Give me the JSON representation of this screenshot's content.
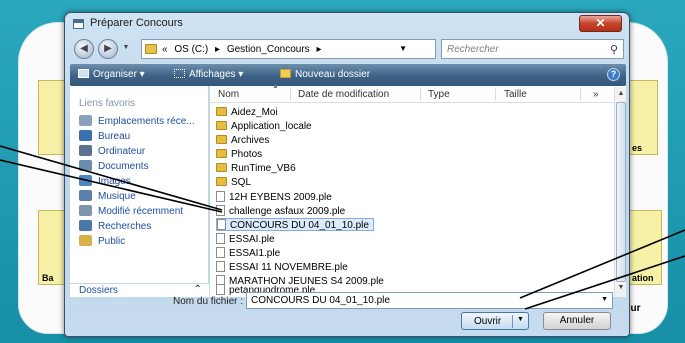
{
  "background": {
    "tile_left_bottom": "Ba",
    "tile_right_top": "es",
    "tile_right_bottom": "ation",
    "bottom_text": "eur"
  },
  "dialog": {
    "title": "Préparer Concours",
    "close_label": "✕"
  },
  "address_bar": {
    "crumbs": [
      "«",
      "OS (C:)",
      "▸",
      "Gestion_Concours",
      "▸"
    ],
    "search_placeholder": "Rechercher"
  },
  "toolbar": {
    "organize": "Organiser ▾",
    "views": "Affichages ▾",
    "new_folder": "Nouveau dossier"
  },
  "nav": {
    "header": "Liens favoris",
    "items": [
      {
        "label": "Emplacements réce...",
        "icon": "recent-places-icon",
        "color": "#8aa1b9"
      },
      {
        "label": "Bureau",
        "icon": "desktop-icon",
        "color": "#3a6fb0"
      },
      {
        "label": "Ordinateur",
        "icon": "computer-icon",
        "color": "#5b7390"
      },
      {
        "label": "Documents",
        "icon": "documents-icon",
        "color": "#6c8db0"
      },
      {
        "label": "Images",
        "icon": "pictures-icon",
        "color": "#4f86c2"
      },
      {
        "label": "Musique",
        "icon": "music-icon",
        "color": "#5a7fa8"
      },
      {
        "label": "Modifié récemment",
        "icon": "recently-changed-icon",
        "color": "#7f95ad"
      },
      {
        "label": "Recherches",
        "icon": "searches-icon",
        "color": "#4b77a8"
      },
      {
        "label": "Public",
        "icon": "public-folder-icon",
        "color": "#d9b14a"
      }
    ],
    "footer": "Dossiers"
  },
  "columns": {
    "name": "Nom",
    "modified": "Date de modification",
    "type": "Type",
    "size": "Taille",
    "more": "»"
  },
  "files": [
    {
      "name": "Aidez_Moi",
      "kind": "folder"
    },
    {
      "name": "Application_locale",
      "kind": "folder"
    },
    {
      "name": "Archives",
      "kind": "folder"
    },
    {
      "name": "Photos",
      "kind": "folder"
    },
    {
      "name": "RunTime_VB6",
      "kind": "folder"
    },
    {
      "name": "SQL",
      "kind": "folder"
    },
    {
      "name": "12H EYBENS 2009.ple",
      "kind": "file"
    },
    {
      "name": "challenge asfaux 2009.ple",
      "kind": "file"
    },
    {
      "name": "CONCOURS DU 04_01_10.ple",
      "kind": "file",
      "selected": true
    },
    {
      "name": "ESSAI.ple",
      "kind": "file"
    },
    {
      "name": "ESSAI1.ple",
      "kind": "file"
    },
    {
      "name": "ESSAI 11 NOVEMBRE.ple",
      "kind": "file"
    },
    {
      "name": "MARATHON JEUNES S4 2009.ple",
      "kind": "file"
    },
    {
      "name": "petanquodrome.ple",
      "kind": "file"
    }
  ],
  "footer": {
    "filename_label": "Nom du fichier :",
    "filename_value": "CONCOURS DU 04_01_10.ple",
    "open_label": "Ouvrir",
    "cancel_label": "Annuler"
  }
}
